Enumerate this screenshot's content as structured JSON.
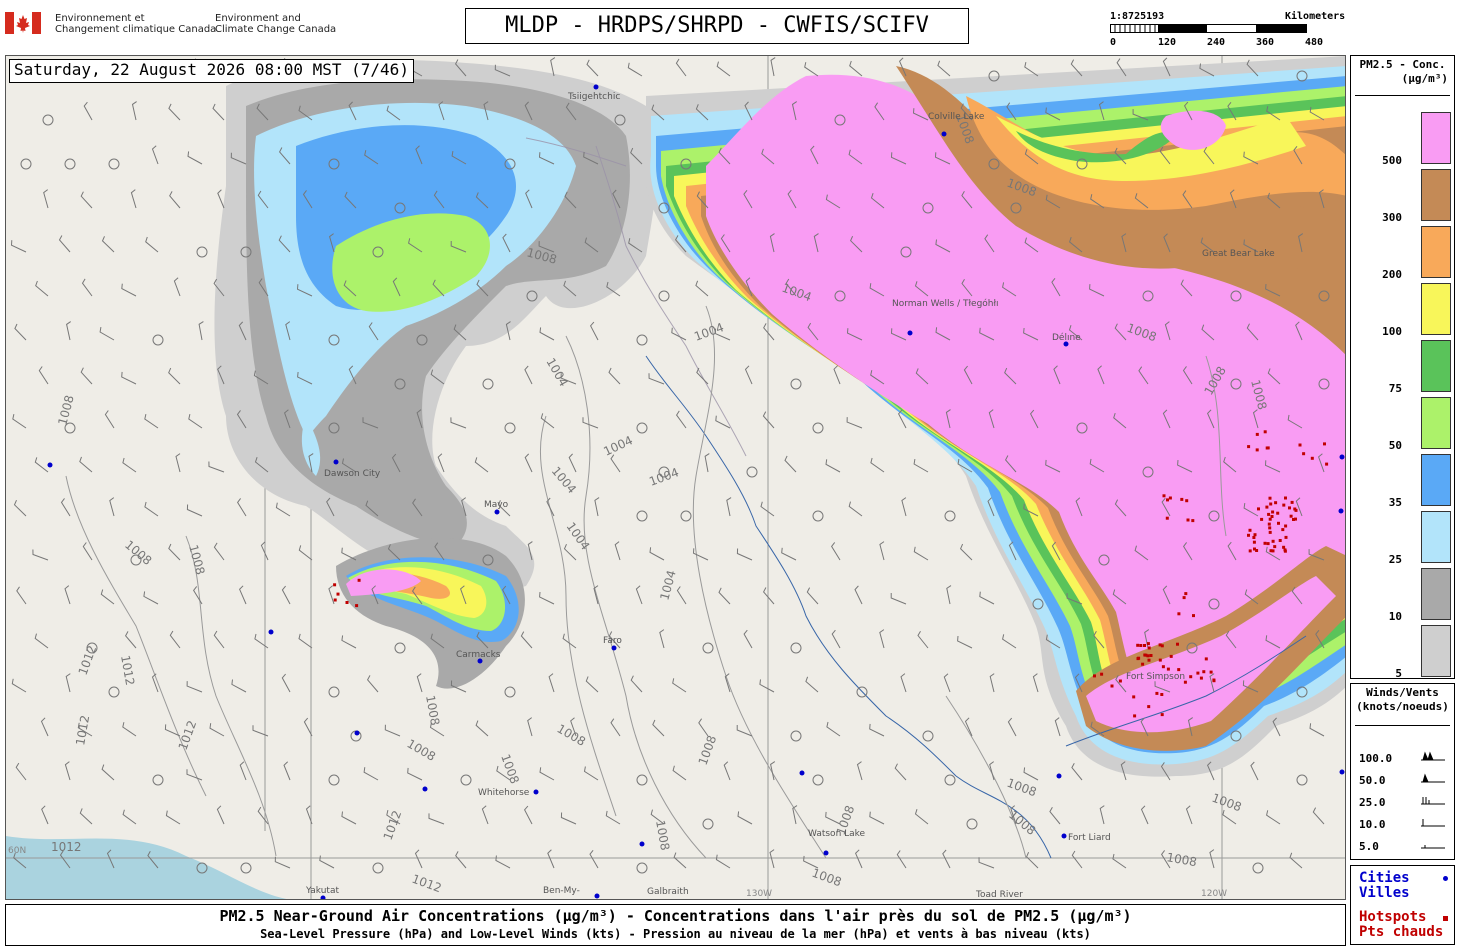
{
  "header": {
    "agency_fr": [
      "Environnement et",
      "Changement climatique Canada"
    ],
    "agency_en": [
      "Environment and",
      "Climate Change Canada"
    ],
    "title": "MLDP - HRDPS/SHRPD - CWFIS/SCIFV"
  },
  "scale_bar": {
    "ratio": "1:8725193",
    "unit_label": "Kilometers",
    "ticks": [
      "0",
      "120",
      "240",
      "360",
      "480"
    ]
  },
  "map": {
    "datetime": "Saturday, 22 August 2026 08:00 MST (7/46)",
    "place_labels": [
      "Tsiigehtchic",
      "Colville Lake",
      "Norman Wells / Tłegóhłı",
      "Délıne",
      "Great Bear Lake",
      "Dawson City",
      "Mayo",
      "Carmacks",
      "Faro",
      "Whitehorse",
      "Fort Simpson",
      "Fort Liard",
      "Watson Lake",
      "Yakutat",
      "Ben-My-",
      "Galbraith",
      "Toad River"
    ],
    "isobar_labels": [
      "1004",
      "1008",
      "1012"
    ],
    "grid_labels": [
      "130W",
      "120W",
      "60N"
    ]
  },
  "pm25_legend": {
    "title_line1": "PM2.5 - Conc.",
    "title_line2": "(µg/m³)",
    "bins": [
      {
        "label": "500",
        "color": "#f99cf3"
      },
      {
        "label": "300",
        "color": "#c48a56"
      },
      {
        "label": "200",
        "color": "#f8a95a"
      },
      {
        "label": "100",
        "color": "#f8f65a"
      },
      {
        "label": "75",
        "color": "#5ac35a"
      },
      {
        "label": "50",
        "color": "#acf26a"
      },
      {
        "label": "35",
        "color": "#5aa9f6"
      },
      {
        "label": "25",
        "color": "#b2e4fa"
      },
      {
        "label": "10",
        "color": "#a9a9a9"
      },
      {
        "label": "5",
        "color": "#cfcfcf"
      }
    ]
  },
  "wind_legend": {
    "title_line1": "Winds/Vents",
    "title_line2": "(knots/noeuds)",
    "rows": [
      "100.0",
      "50.0",
      "25.0",
      "10.0",
      "5.0"
    ]
  },
  "symbols_legend": {
    "cities": "Cities",
    "villes": "Villes",
    "hotspots": "Hotspots",
    "pts_chauds": "Pts chauds",
    "city_color": "#0000cc",
    "hotspot_color": "#c00000"
  },
  "caption": {
    "line1": "PM2.5 Near-Ground Air Concentrations (µg/m³) - Concentrations dans l'air près du sol de PM2.5 (µg/m³)",
    "line2": "Sea-Level Pressure (hPa) and Low-Level Winds (kts) - Pression au niveau de la mer (hPa) et vents à bas niveau (kts)"
  }
}
